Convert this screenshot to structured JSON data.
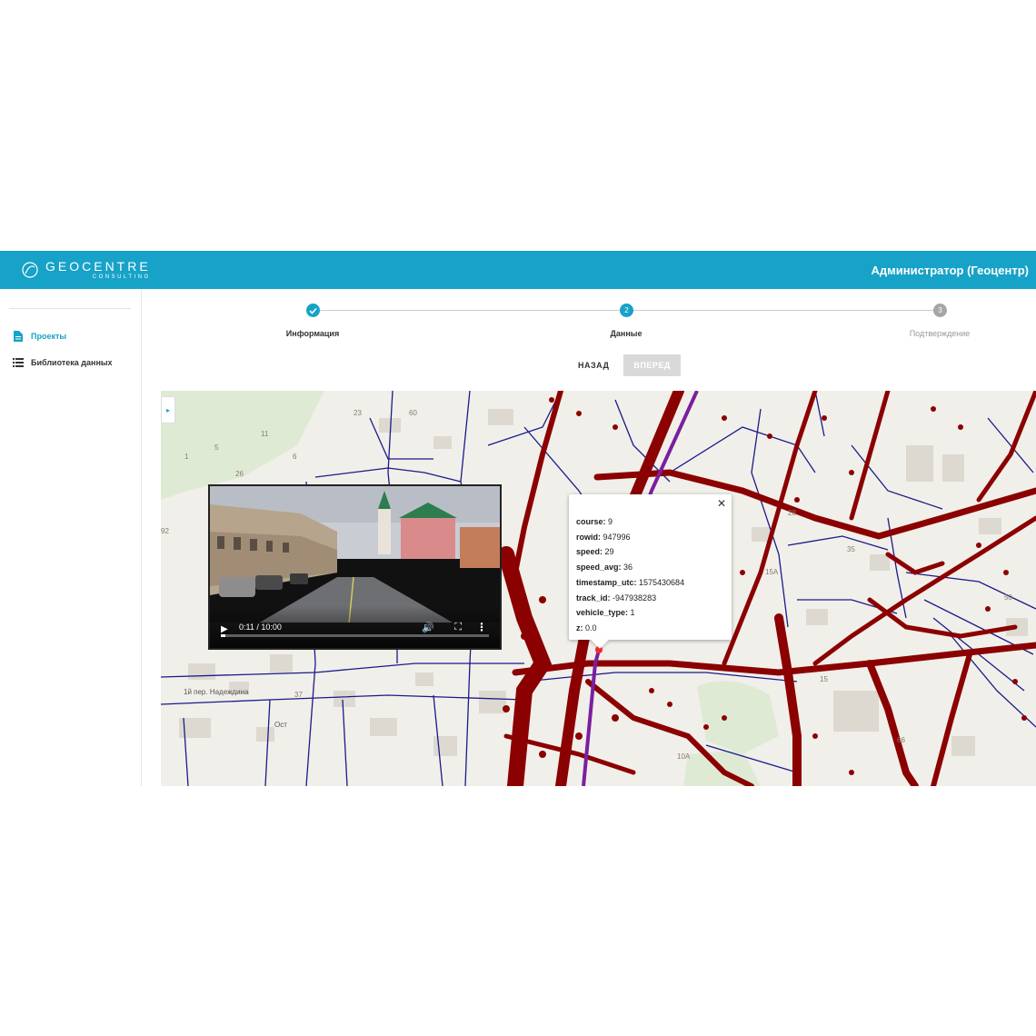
{
  "header": {
    "logo_main": "GEOCENTRE",
    "logo_sub": "CONSULTING",
    "user_name": "Администратор (Геоцентр)",
    "color": "#17a2c8"
  },
  "sidebar": {
    "items": [
      {
        "label": "Проекты",
        "icon": "document-icon",
        "active": true
      },
      {
        "label": "Библиотека данных",
        "icon": "list-icon",
        "active": false
      }
    ]
  },
  "stepper": {
    "steps": [
      {
        "number": "1",
        "label": "Информация",
        "state": "done"
      },
      {
        "number": "2",
        "label": "Данные",
        "state": "active"
      },
      {
        "number": "3",
        "label": "Подтверждение",
        "state": "pending"
      }
    ]
  },
  "buttons": {
    "back": "НАЗАД",
    "next": "ВПЕРЕД"
  },
  "map": {
    "labels": [
      "23",
      "60",
      "11",
      "5",
      "1",
      "6",
      "26",
      "92",
      "37",
      "10A",
      "28",
      "35",
      "15A",
      "50",
      "15",
      "66",
      "1й пер. Надеждина",
      "Ост"
    ],
    "track_color": "#8b0000",
    "road_color": "#1a1a8c"
  },
  "video": {
    "time": "0:11 / 10:00",
    "progress": 0.018
  },
  "popup": {
    "rows": [
      {
        "key": "course:",
        "value": "9"
      },
      {
        "key": "rowid:",
        "value": "947996"
      },
      {
        "key": "speed:",
        "value": "29"
      },
      {
        "key": "speed_avg:",
        "value": "36"
      },
      {
        "key": "timestamp_utc:",
        "value": "1575430684"
      },
      {
        "key": "track_id:",
        "value": "-947938283"
      },
      {
        "key": "vehicle_type:",
        "value": "1"
      },
      {
        "key": "z:",
        "value": "0.0"
      }
    ]
  }
}
